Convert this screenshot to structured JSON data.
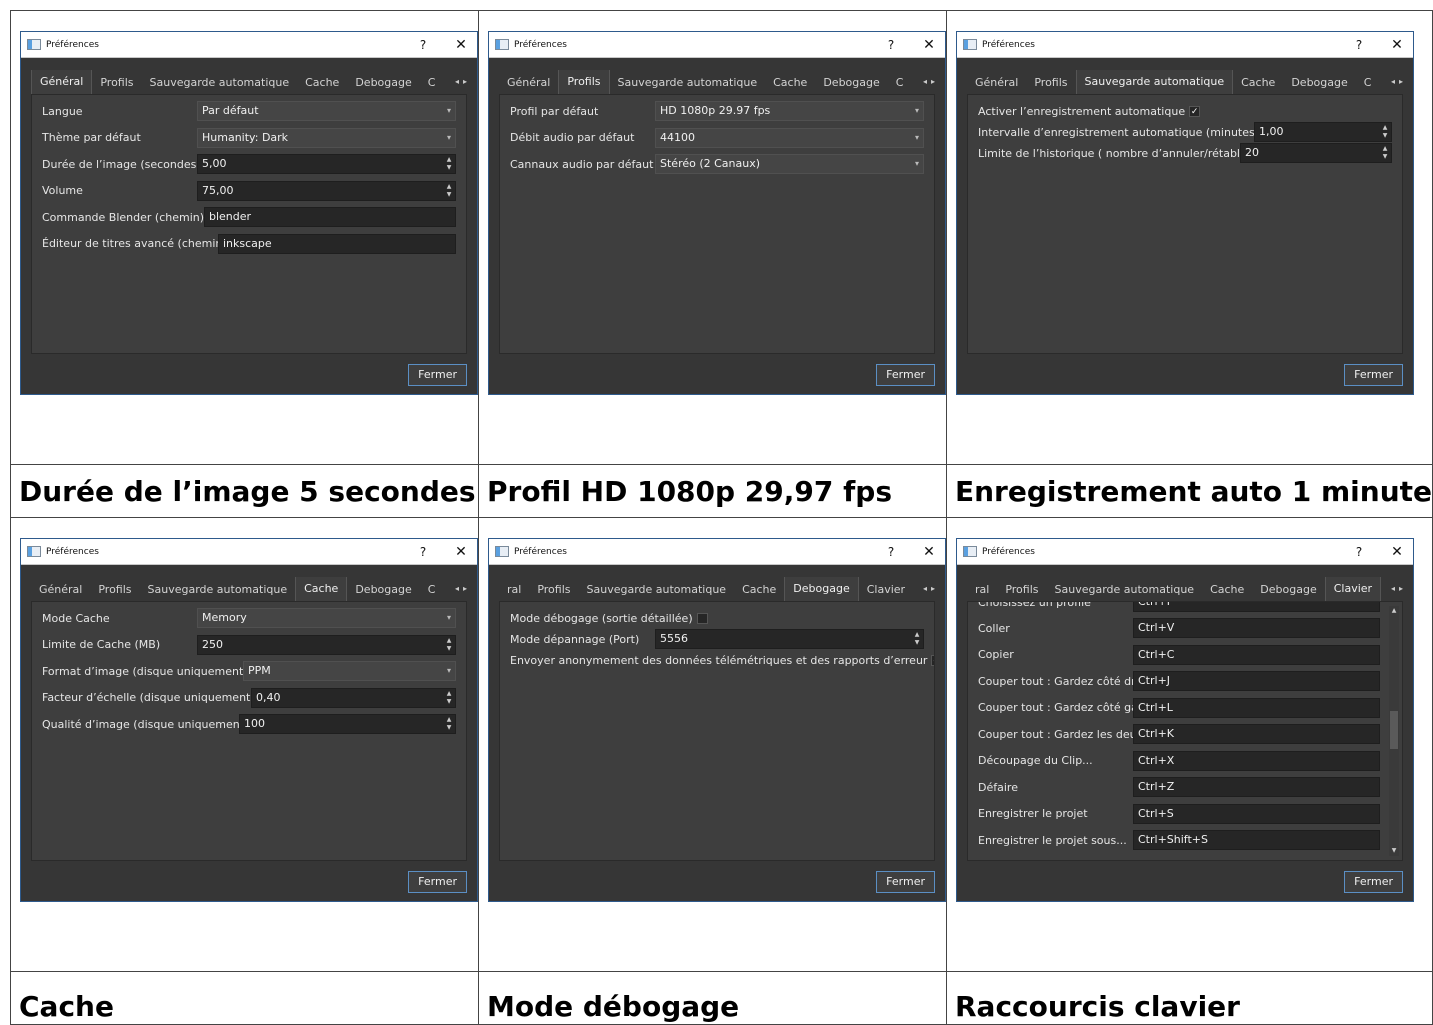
{
  "window_title": "Préférences",
  "help_glyph": "?",
  "close_glyph": "✕",
  "close_button": "Fermer",
  "tab_scroll": [
    "◂",
    "▸"
  ],
  "panels": [
    {
      "caption": "Durée de l’image 5 secondes",
      "tabs": [
        "Général",
        "Profils",
        "Sauvegarde automatique",
        "Cache",
        "Debogage",
        "C"
      ],
      "active_tab": 0,
      "rows": [
        {
          "label": "Langue",
          "value": "Par défaut",
          "kind": "combo"
        },
        {
          "label": "Thème par défaut",
          "value": "Humanity: Dark",
          "kind": "combo"
        },
        {
          "label": "Durée de l’image (secondes)",
          "value": "5,00",
          "kind": "spin"
        },
        {
          "label": "Volume",
          "value": "75,00",
          "kind": "spin"
        },
        {
          "label": "Commande Blender (chemin)",
          "value": "blender",
          "kind": "text"
        },
        {
          "label": "Éditeur de titres avancé (chemin)",
          "value": "inkscape",
          "kind": "text"
        }
      ]
    },
    {
      "caption": "Profil HD 1080p 29,97 fps",
      "tabs": [
        "Général",
        "Profils",
        "Sauvegarde automatique",
        "Cache",
        "Debogage",
        "C"
      ],
      "active_tab": 1,
      "rows": [
        {
          "label": "Profil par défaut",
          "value": "HD 1080p 29.97 fps",
          "kind": "combo"
        },
        {
          "label": "Débit audio par défaut",
          "value": "44100",
          "kind": "combo"
        },
        {
          "label": "Cannaux audio par défaut",
          "value": "Stéréo (2 Canaux)",
          "kind": "combo"
        }
      ]
    },
    {
      "caption": "Enregistrement auto 1 minute",
      "tabs": [
        "Général",
        "Profils",
        "Sauvegarde automatique",
        "Cache",
        "Debogage",
        "C"
      ],
      "active_tab": 2,
      "rows": [
        {
          "label": "Activer l’enregistrement automatique",
          "value": "✓",
          "kind": "check"
        },
        {
          "label": "Intervalle d’enregistrement automatique (minutes)",
          "value": "1,00",
          "kind": "spin"
        },
        {
          "label": "Limite de l’historique ( nombre d’annuler/rétablir)",
          "value": "20",
          "kind": "spin"
        }
      ]
    },
    {
      "caption": "Cache",
      "tabs": [
        "Général",
        "Profils",
        "Sauvegarde automatique",
        "Cache",
        "Debogage",
        "C"
      ],
      "active_tab": 3,
      "rows": [
        {
          "label": "Mode Cache",
          "value": "Memory",
          "kind": "combo"
        },
        {
          "label": "Limite de Cache (MB)",
          "value": "250",
          "kind": "spin"
        },
        {
          "label": "Format d’image (disque uniquement)",
          "value": "PPM",
          "kind": "combo"
        },
        {
          "label": "Facteur d’échelle (disque uniquement)",
          "value": "0,40",
          "kind": "spin"
        },
        {
          "label": "Qualité d’image (disque uniquement)",
          "value": "100",
          "kind": "spin"
        }
      ]
    },
    {
      "caption": "Mode débogage",
      "tabs": [
        "ral",
        "Profils",
        "Sauvegarde automatique",
        "Cache",
        "Debogage",
        "Clavier"
      ],
      "active_tab": 4,
      "rows": [
        {
          "label": "Mode débogage (sortie détaillée)",
          "value": "",
          "kind": "check"
        },
        {
          "label": "Mode dépannage (Port)",
          "value": "5556",
          "kind": "spin"
        },
        {
          "label": "Envoyer anonymement des données télémétriques et des rapports d’erreur",
          "value": "✓",
          "kind": "check"
        }
      ]
    },
    {
      "caption": "Raccourcis clavier",
      "tabs": [
        "ral",
        "Profils",
        "Sauvegarde automatique",
        "Cache",
        "Debogage",
        "Clavier"
      ],
      "active_tab": 5,
      "partial_row": {
        "label": "Choisissez un profile",
        "value": "Ctrl+P"
      },
      "rows": [
        {
          "label": "Coller",
          "value": "Ctrl+V",
          "kind": "text"
        },
        {
          "label": "Copier",
          "value": "Ctrl+C",
          "kind": "text"
        },
        {
          "label": "Couper tout : Gardez côté droit",
          "value": "Ctrl+J",
          "kind": "text"
        },
        {
          "label": "Couper tout : Gardez côté gauche",
          "value": "Ctrl+L",
          "kind": "text"
        },
        {
          "label": "Couper tout : Gardez les deux côtés",
          "value": "Ctrl+K",
          "kind": "text"
        },
        {
          "label": "Découpage du Clip...",
          "value": "Ctrl+X",
          "kind": "text"
        },
        {
          "label": "Défaire",
          "value": "Ctrl+Z",
          "kind": "text"
        },
        {
          "label": "Enregistrer le projet",
          "value": "Ctrl+S",
          "kind": "text"
        },
        {
          "label": "Enregistrer le projet sous...",
          "value": "Ctrl+Shift+S",
          "kind": "text"
        }
      ]
    }
  ]
}
